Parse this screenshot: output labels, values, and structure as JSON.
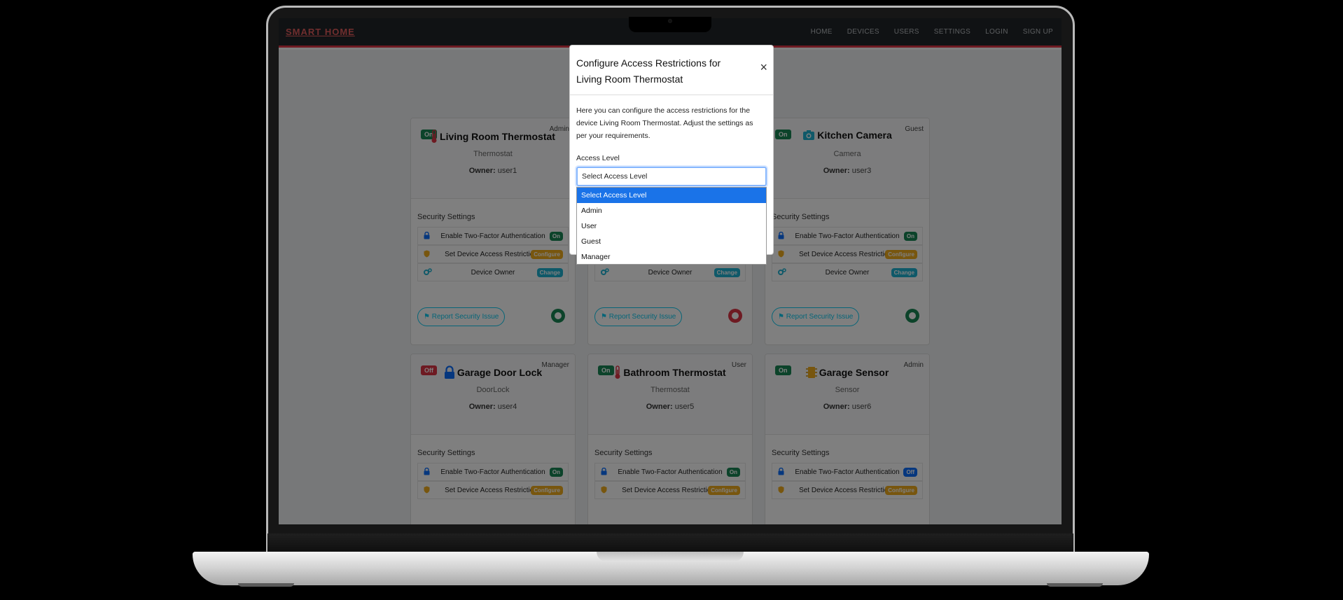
{
  "navbar": {
    "brand": "SMART HOME",
    "links": [
      "HOME",
      "DEVICES",
      "USERS",
      "SETTINGS",
      "LOGIN",
      "SIGN UP"
    ]
  },
  "devices": [
    {
      "name": "Living Room Thermostat",
      "type": "Thermostat",
      "owner": "user1",
      "role": "Admin",
      "status": "On",
      "icon": "thermometer-icon",
      "two_factor": "On",
      "toggle_color": "#198754"
    },
    {
      "name": "",
      "type": "",
      "owner": "",
      "role": "",
      "status": "",
      "icon": "",
      "two_factor": "",
      "toggle_color": "#dc3545"
    },
    {
      "name": "Kitchen Camera",
      "type": "Camera",
      "owner": "user3",
      "role": "Guest",
      "status": "On",
      "icon": "camera-icon",
      "two_factor": "On",
      "toggle_color": "#198754"
    },
    {
      "name": "Garage Door Lock",
      "type": "DoorLock",
      "owner": "user4",
      "role": "Manager",
      "status": "Off",
      "icon": "lock-icon",
      "two_factor": "On"
    },
    {
      "name": "Bathroom Thermostat",
      "type": "Thermostat",
      "owner": "user5",
      "role": "User",
      "status": "On",
      "icon": "thermometer-icon",
      "two_factor": "On"
    },
    {
      "name": "Garage Sensor",
      "type": "Sensor",
      "owner": "user6",
      "role": "Admin",
      "status": "On",
      "icon": "sensor-icon",
      "two_factor": "Off"
    }
  ],
  "labels": {
    "owner": "Owner:",
    "security_settings": "Security Settings",
    "two_factor": "Enable Two-Factor Authentication",
    "access_restrictions": "Set Device Access Restrictions",
    "device_owner": "Device Owner",
    "configure": "Configure",
    "change": "Change",
    "report": "Report Security Issue"
  },
  "modal": {
    "title": "Configure Access Restrictions for Living Room Thermostat",
    "close": "×",
    "body": "Here you can configure the access restrictions for the device Living Room Thermostat. Adjust the settings as per your requirements.",
    "field_label": "Access Level",
    "selected": "Select Access Level",
    "options": [
      "Select Access Level",
      "Admin",
      "User",
      "Guest",
      "Manager"
    ]
  },
  "colors": {
    "accent": "#dc3545",
    "success": "#198754",
    "warning": "#f0ad1c",
    "info": "#1fb3d2",
    "primary": "#0d6efd",
    "selected_option": "#1a73e8"
  }
}
